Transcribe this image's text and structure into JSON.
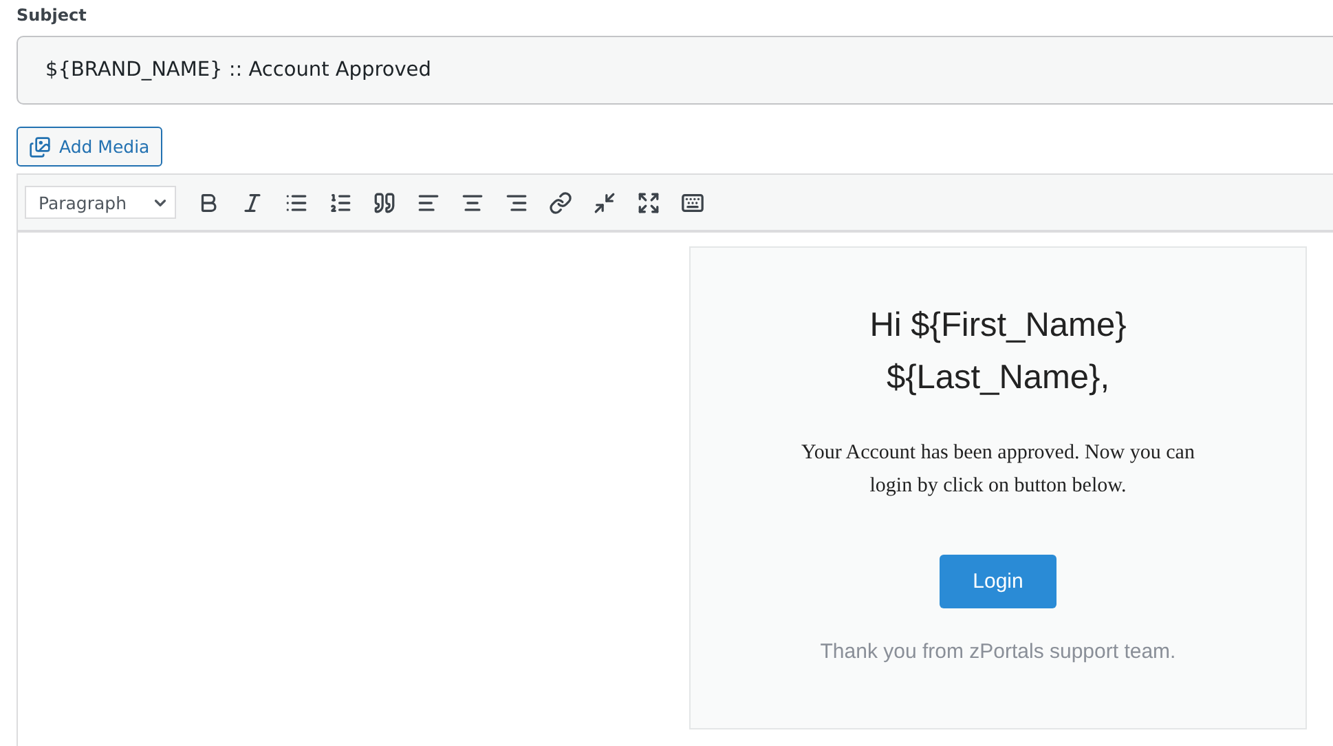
{
  "subject": {
    "label": "Subject",
    "value": "${BRAND_NAME} :: Account Approved"
  },
  "add_media": {
    "label": "Add Media"
  },
  "toolbar": {
    "format": "Paragraph"
  },
  "email": {
    "greeting_line_1": "Hi ${First_Name}",
    "greeting_line_2": "${Last_Name},",
    "message": "Your Account has been approved. Now you can login by click on button below.",
    "button": "Login",
    "footer": "Thank you from zPortals support team."
  }
}
